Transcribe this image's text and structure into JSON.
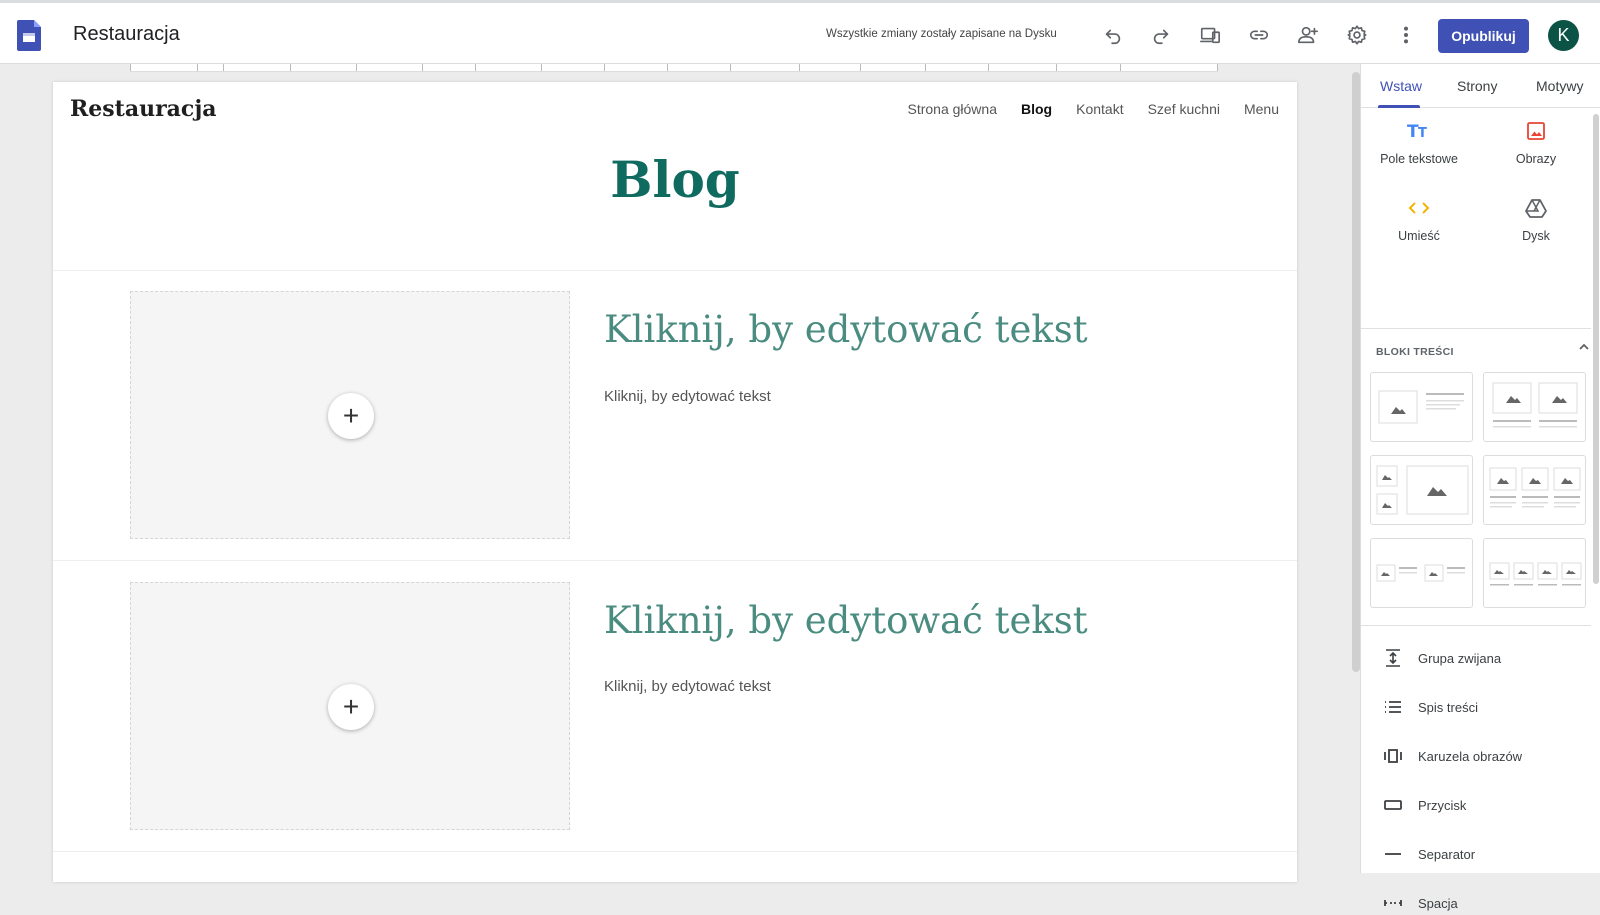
{
  "header": {
    "title": "Restauracja",
    "save_status": "Wszystkie zmiany zostały zapisane na Dysku",
    "publish_label": "Opublikuj",
    "avatar_letter": "K",
    "icons": [
      "undo-icon",
      "redo-icon",
      "preview-devices-icon",
      "link-icon",
      "share-icon",
      "settings-icon",
      "more-vert-icon"
    ]
  },
  "site": {
    "name": "Restauracja",
    "nav": [
      "Strona główna",
      "Blog",
      "Kontakt",
      "Szef kuchni",
      "Menu"
    ],
    "active_nav": "Blog",
    "heading": "Blog",
    "posts": [
      {
        "title": "Kliknij, by edytować tekst",
        "body": "Kliknij, by edytować tekst"
      },
      {
        "title": "Kliknij, by edytować tekst",
        "body": "Kliknij, by edytować tekst"
      }
    ]
  },
  "panel": {
    "tabs": [
      "Wstaw",
      "Strony",
      "Motywy"
    ],
    "active_tab": "Wstaw",
    "insert_items": [
      "Pole tekstowe",
      "Obrazy",
      "Umieść",
      "Dysk"
    ],
    "section_label": "BLOKI TREŚCI",
    "list_items": [
      "Grupa zwijana",
      "Spis treści",
      "Karuzela obrazów",
      "Przycisk",
      "Separator",
      "Spacja"
    ]
  },
  "colors": {
    "accent": "#3f51b5",
    "heading_green": "#0f6b5f",
    "title_green": "#4b8c80",
    "avatar_bg": "#0b5345"
  }
}
